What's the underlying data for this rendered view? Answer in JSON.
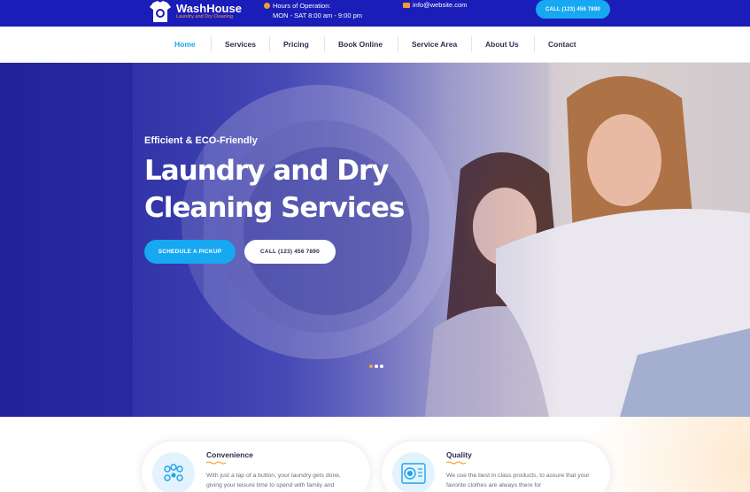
{
  "topbar": {
    "brand": "WashHouse",
    "tagline": "Laundry and Dry Cleaning",
    "hours_label": "Hours of Operation:",
    "hours_value": "MON - SAT 8:00 am - 9:00 pm",
    "email": "info@website.com",
    "call_button": "CALL (123) 456 7890"
  },
  "nav": {
    "items": [
      {
        "label": "Home"
      },
      {
        "label": "Services"
      },
      {
        "label": "Pricing"
      },
      {
        "label": "Book Online"
      },
      {
        "label": "Service Area"
      },
      {
        "label": "About Us"
      },
      {
        "label": "Contact"
      }
    ],
    "active": "Home"
  },
  "hero": {
    "eyebrow": "Efficient & ECO-Friendly",
    "title_line1": "Laundry and Dry",
    "title_line2": "Cleaning Services",
    "primary_button": "SCHEDULE A PICKUP",
    "secondary_button": "CALL (123) 456 7890",
    "slides": 3,
    "active_slide": 1
  },
  "features": [
    {
      "title": "Convenience",
      "icon": "people-network-icon",
      "desc": "With just a tap of a button, your laundry gets done, giving your leisure time to spend with family and"
    },
    {
      "title": "Quality",
      "icon": "washing-machine-icon",
      "desc": "We use the best in class products, to assure that your favorite clothes are always there for"
    }
  ],
  "colors": {
    "topbar": "#1b1db8",
    "accent_blue": "#17a8f2",
    "accent_orange": "#f6a53a",
    "heading": "#2a2d50"
  }
}
